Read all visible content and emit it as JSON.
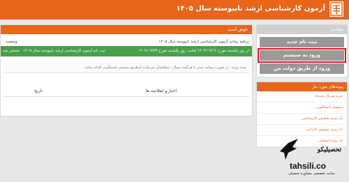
{
  "header": {
    "title": "آزمون کارشناسی ارشد ناپیوسته سال ۱۴۰۵"
  },
  "sidebar": {
    "box_title": "متقاضی",
    "buttons": [
      "ثبت نام جدید",
      "ورود به سیستم",
      "ورود از طریق دولت من"
    ],
    "links_title": "پیوندهای مورد نیاز",
    "links": [
      "خرید سریال ثبت‌نام",
      "سیستم پاسخگویی",
      "کد رشته تحصیلی کارشناسی",
      "کد رشته تحصیلی کاردانی",
      "کد رشته امتحانی"
    ]
  },
  "main": {
    "header": "خوش آمدید",
    "col_status": "وضعیت",
    "row1_title": "برنامه زمانی آزمون کارشناسی ارشد ناپیوسته سال ۱۴۰۵",
    "row2_status": "منتشر شد",
    "row2_title": "ثبت نام آزمون کارشناسی ارشد ناپیوسته سال ۱۴۰۵",
    "row2_date": "از روز یکشنبه مورخ ۱۴۰۴/۰۹/۱۶ لغایت روز یکشنبه مورخ ۱۴۰۴/۰۹/۲۳",
    "note": "توجه ویژه : در صورت مواجه شدن با هرگونه سوال ، متقاضیان می‌توانند ازطریق سیستم پاسخگویی اقدام نمایند.",
    "news_date": "تاریخ",
    "news_title": "اخبار و اطلاعیه ها"
  },
  "watermark": {
    "brand": "تحصیلیکو",
    "url": "tahsili.co",
    "sub": "سایت تخصصی مشاوره تحصیلی"
  }
}
